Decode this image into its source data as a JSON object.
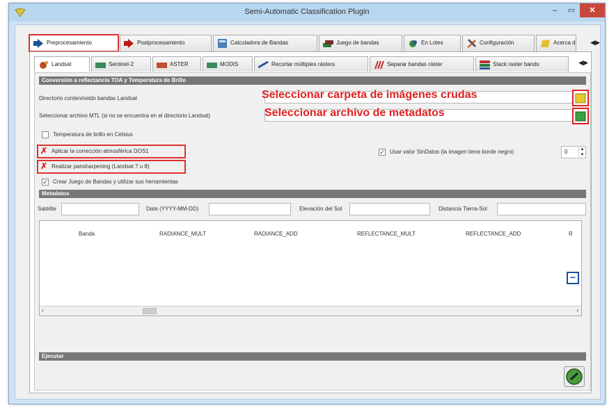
{
  "window": {
    "title": "Semi-Automatic Classification Plugin"
  },
  "controls": {
    "minimize": "‒",
    "maximize": "▭",
    "close": "✕"
  },
  "main_tabs": [
    {
      "label": "Preprocesamiento",
      "icon": "arrow-right-icon"
    },
    {
      "label": "Postprocesamiento",
      "icon": "arrow-right-icon"
    },
    {
      "label": "Calculadora de Bandas",
      "icon": "calculator-icon"
    },
    {
      "label": "Juego de bandas",
      "icon": "layers-icon"
    },
    {
      "label": "En Lotes",
      "icon": "batch-icon"
    },
    {
      "label": "Configuración",
      "icon": "tools-icon"
    },
    {
      "label": "Acerca de",
      "icon": "about-icon"
    }
  ],
  "sub_tabs": [
    {
      "label": "Landsat"
    },
    {
      "label": "Sentinel-2"
    },
    {
      "label": "ASTER"
    },
    {
      "label": "MODIS"
    },
    {
      "label": "Recortar múltiples rásters"
    },
    {
      "label": "Separar bandas ráster"
    },
    {
      "label": "Stack raster bands"
    }
  ],
  "conversion": {
    "header": "Conversión a reflectancia TOA y Temperatura de Brillo",
    "dir_label": "Directorio contenineido bandas Landsat",
    "mtl_label": "Seleccionar archivo MTL (si no se encuentra en el directorio Landsat)",
    "annot_folder": "Seleccionar carpeta de imágenes crudas",
    "annot_metadata": "Seleccionar archivo de metadatos",
    "temp_celsius": "Temperatura de brillo en Celsius",
    "dos1": "Aplicar la corrección atmosférica DOS1",
    "pansharpening": "Realizar pansharpening (Landsat 7 u 8)",
    "create_bandset": "Crear Juego de Bandas y utilizar sus herramientas",
    "nodata_label": "Usar valor SinDatos (la imagen tiene borde negro)",
    "nodata_value": "0"
  },
  "metadata": {
    "header": "Metadatos",
    "satellite": "Satélite",
    "date": "Date (YYYY-MM-DD)",
    "sun_elevation": "Elevación del Sol",
    "earth_sun_distance": "Distancia Tierra-Sol",
    "columns": [
      "Banda",
      "RADIANCE_MULT",
      "RADIANCE_ADD",
      "REFLECTANCE_MULT",
      "REFLECTANCE_ADD",
      "R"
    ]
  },
  "run": {
    "header": "Ejecutar"
  },
  "colors": {
    "accent_red": "#e02020",
    "section_header": "#777777"
  }
}
